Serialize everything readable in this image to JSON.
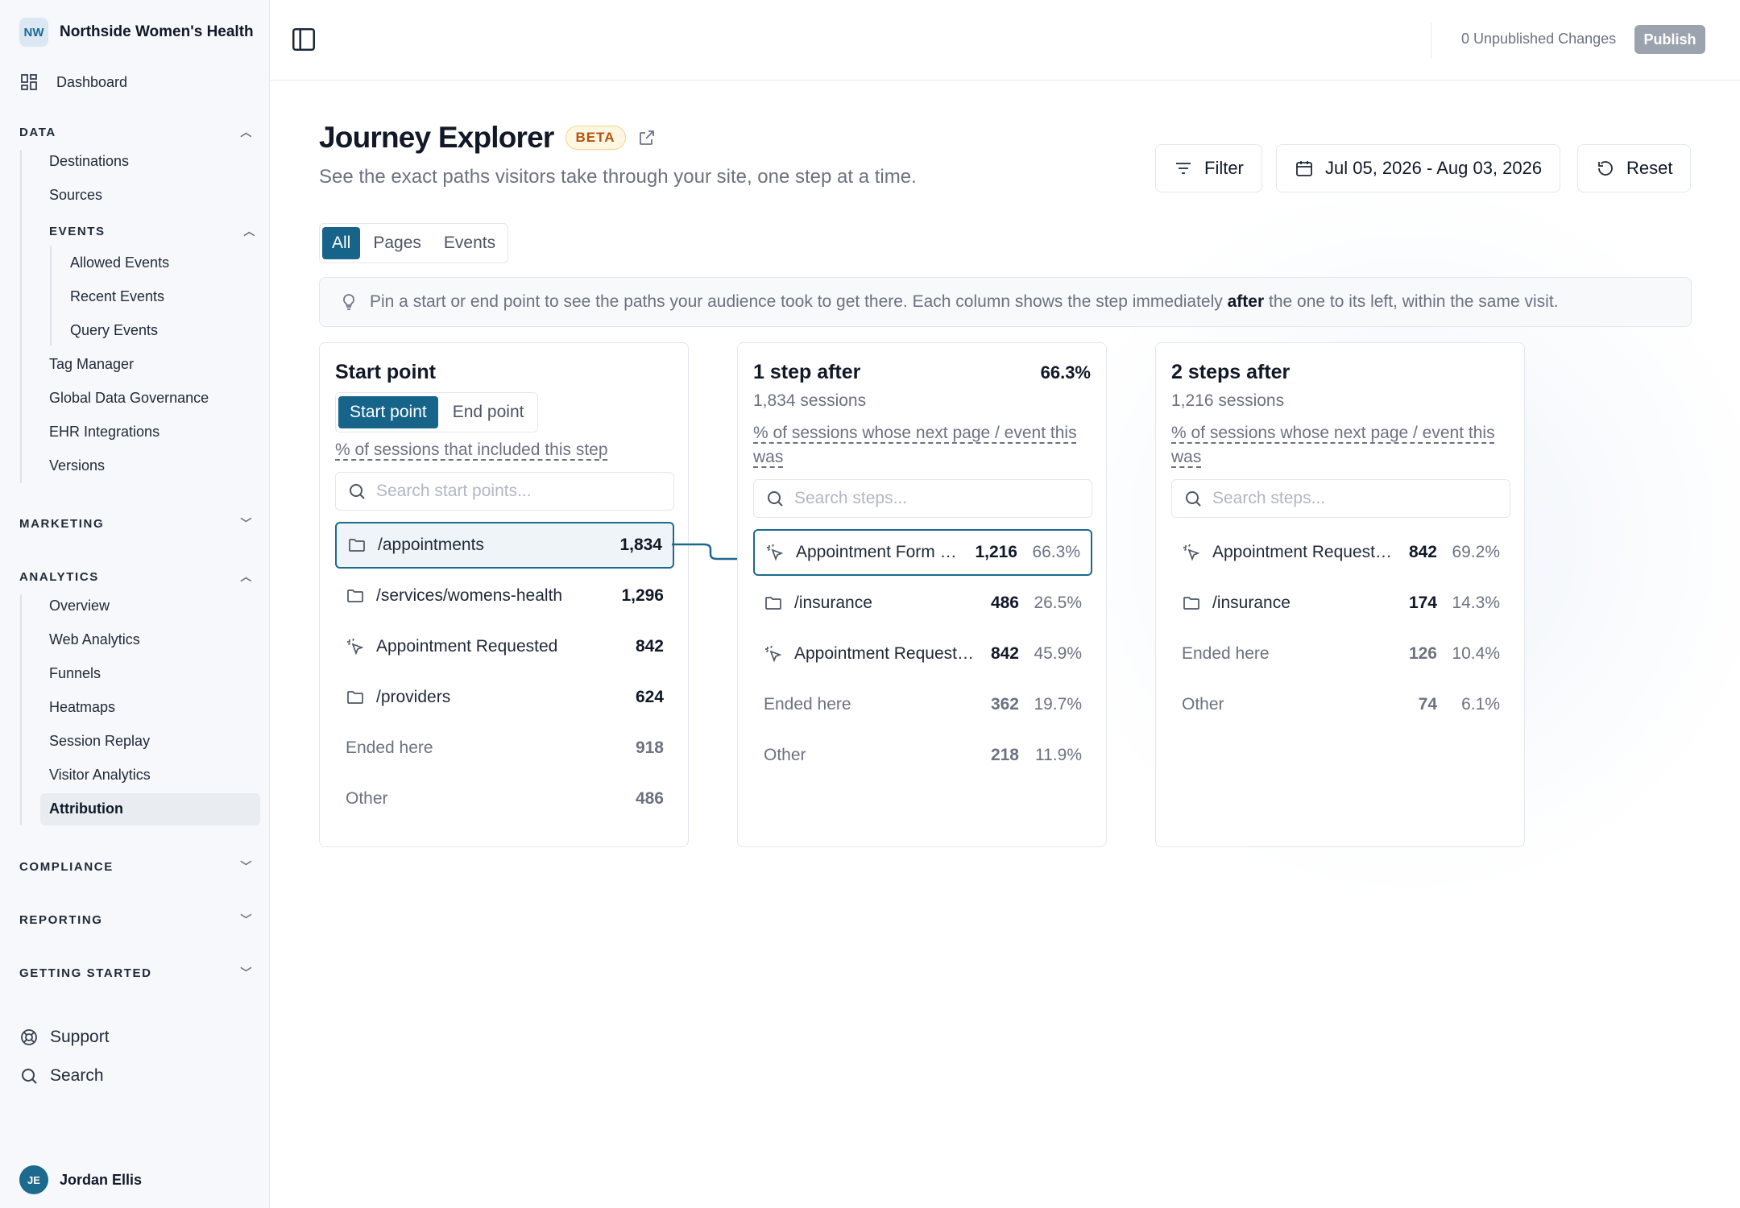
{
  "org": {
    "initials": "NW",
    "name": "Northside Women's Health"
  },
  "nav": {
    "dashboard": "Dashboard",
    "data": {
      "label": "DATA",
      "items": [
        "Destinations",
        "Sources"
      ],
      "events": {
        "label": "EVENTS",
        "items": [
          "Allowed Events",
          "Recent Events",
          "Query Events"
        ]
      },
      "items_after": [
        "Tag Manager",
        "Global Data Governance",
        "EHR Integrations",
        "Versions"
      ]
    },
    "marketing": "MARKETING",
    "analytics": {
      "label": "ANALYTICS",
      "items": [
        "Overview",
        "Web Analytics",
        "Funnels",
        "Heatmaps",
        "Session Replay",
        "Visitor Analytics",
        "Attribution"
      ]
    },
    "compliance": "COMPLIANCE",
    "reporting": "REPORTING",
    "getting_started": "GETTING STARTED",
    "support": "Support",
    "search": "Search"
  },
  "user": {
    "initials": "JE",
    "name": "Jordan Ellis"
  },
  "topbar": {
    "unpublished": "0 Unpublished Changes",
    "publish": "Publish"
  },
  "page": {
    "title": "Journey Explorer",
    "badge": "BETA",
    "subtitle": "See the exact paths visitors take through your site, one step at a time.",
    "filter": "Filter",
    "date_range": "Jul 05, 2026 - Aug 03, 2026",
    "reset": "Reset",
    "tabs": [
      "All",
      "Pages",
      "Events"
    ],
    "info_before": "Pin a start or end point to see the paths your audience took to get there. Each column shows the step immediately ",
    "info_bold": "after",
    "info_after": " the one to its left, within the same visit."
  },
  "columns": {
    "start": {
      "title": "Start point",
      "toggle": [
        "Start point",
        "End point"
      ],
      "note": "% of sessions that included this step",
      "search_placeholder": "Search start points...",
      "rows": [
        {
          "icon": "folder",
          "label": "/appointments",
          "count": "1,834"
        },
        {
          "icon": "folder",
          "label": "/services/womens-health",
          "count": "1,296"
        },
        {
          "icon": "event",
          "label": "Appointment Requested",
          "count": "842"
        },
        {
          "icon": "folder",
          "label": "/providers",
          "count": "624"
        },
        {
          "icon": "",
          "label": "Ended here",
          "count": "918"
        },
        {
          "icon": "",
          "label": "Other",
          "count": "486"
        }
      ]
    },
    "step1": {
      "title": "1 step after",
      "pct": "66.3%",
      "sessions": "1,834 sessions",
      "note": "% of sessions whose next page / event this was",
      "search_placeholder": "Search steps...",
      "rows": [
        {
          "icon": "event",
          "label": "Appointment Form …",
          "count": "1,216",
          "pct": "66.3%"
        },
        {
          "icon": "folder",
          "label": "/insurance",
          "count": "486",
          "pct": "26.5%"
        },
        {
          "icon": "event",
          "label": "Appointment Request…",
          "count": "842",
          "pct": "45.9%"
        },
        {
          "icon": "",
          "label": "Ended here",
          "count": "362",
          "pct": "19.7%"
        },
        {
          "icon": "",
          "label": "Other",
          "count": "218",
          "pct": "11.9%"
        }
      ]
    },
    "step2": {
      "title": "2 steps after",
      "sessions": "1,216 sessions",
      "note": "% of sessions whose next page / event this was",
      "search_placeholder": "Search steps...",
      "rows": [
        {
          "icon": "event",
          "label": "Appointment Request…",
          "count": "842",
          "pct": "69.2%"
        },
        {
          "icon": "folder",
          "label": "/insurance",
          "count": "174",
          "pct": "14.3%"
        },
        {
          "icon": "",
          "label": "Ended here",
          "count": "126",
          "pct": "10.4%"
        },
        {
          "icon": "",
          "label": "Other",
          "count": "74",
          "pct": "6.1%"
        }
      ]
    }
  },
  "colors": {
    "accent": "#16648a",
    "beta_bg": "#fff7e1",
    "beta_text": "#b45309"
  }
}
